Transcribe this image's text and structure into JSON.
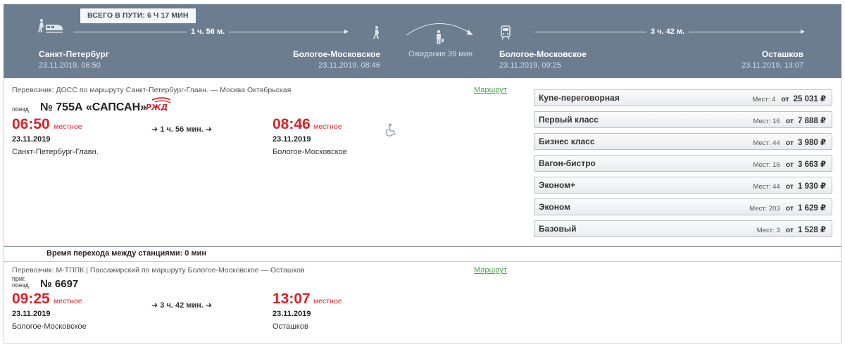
{
  "journey": {
    "total_label": "ВСЕГО В ПУТИ: 6 Ч 17 МИН",
    "leg1_duration": "1 ч. 56 м.",
    "leg2_duration": "3 ч. 42 м.",
    "wait_label": "Ожидание 39 мин",
    "stations": [
      {
        "name": "Санкт-Петербург",
        "datetime": "23.11.2019, 06:50"
      },
      {
        "name": "Бологое-Московское",
        "datetime": "23.11.2019, 08:46"
      },
      {
        "name": "Бологое-Московское",
        "datetime": "23.11.2019, 09:25"
      },
      {
        "name": "Осташков",
        "datetime": "23.11.2019, 13:07"
      }
    ]
  },
  "segments": [
    {
      "carrier": "Перевозчик: ДОСС   по маршруту Санкт-Петербург-Главн. — Москва Октябрьская",
      "route_link": "Маршрут",
      "train_kind": "поезд",
      "train_number": "№ 755А «САПСАН»",
      "dep_time": "06:50",
      "dep_local": "местное",
      "dep_date": "23.11.2019",
      "dep_station": "Санкт-Петербург-Главн.",
      "duration": "1 ч. 56 мин.",
      "arr_time": "08:46",
      "arr_local": "местное",
      "arr_date": "23.11.2019",
      "arr_station": "Бологое-Московское"
    },
    {
      "carrier": "Перевозчик: М-ТППК | Пассажирский   по маршруту Бологое-Московское — Осташков",
      "route_link": "Маршрут",
      "train_kind_1": "приг.",
      "train_kind_2": "поезд",
      "train_number": "№ 6697",
      "dep_time": "09:25",
      "dep_local": "местное",
      "dep_date": "23.11.2019",
      "dep_station": "Бологое-Московское",
      "duration": "3 ч. 42 мин.",
      "arr_time": "13:07",
      "arr_local": "местное",
      "arr_date": "23.11.2019",
      "arr_station": "Осташков"
    }
  ],
  "transfer_text": "Время перехода между станциями: 0 мин",
  "seat_classes": [
    {
      "name": "Купе-переговорная",
      "seats": "Мест: 4",
      "from": "от",
      "price": "25 031 ₽"
    },
    {
      "name": "Первый класс",
      "seats": "Мест: 16",
      "from": "от",
      "price": "7 888 ₽"
    },
    {
      "name": "Бизнес класс",
      "seats": "Мест: 44",
      "from": "от",
      "price": "3 980 ₽"
    },
    {
      "name": "Вагон-бистро",
      "seats": "Мест: 16",
      "from": "от",
      "price": "3 663 ₽"
    },
    {
      "name": "Эконом+",
      "seats": "Мест: 44",
      "from": "от",
      "price": "1 930 ₽"
    },
    {
      "name": "Эконом",
      "seats": "Мест: 203",
      "from": "от",
      "price": "1 629 ₽"
    },
    {
      "name": "Базовый",
      "seats": "Мест: 3",
      "from": "от",
      "price": "1 528 ₽"
    }
  ],
  "icons": {
    "high_speed_train": "high-speed-train-icon",
    "walking_person": "walking-person-icon",
    "waiting_person": "waiting-person-icon",
    "suburban_train": "suburban-train-icon",
    "wheelchair": "wheelchair-icon",
    "rzd_logo": "rzd-logo-icon",
    "arrow": "arrow-right-icon"
  },
  "colors": {
    "header_bg": "#6b7d8f",
    "time_red": "#d8232a",
    "link_green": "#4aa54a"
  }
}
